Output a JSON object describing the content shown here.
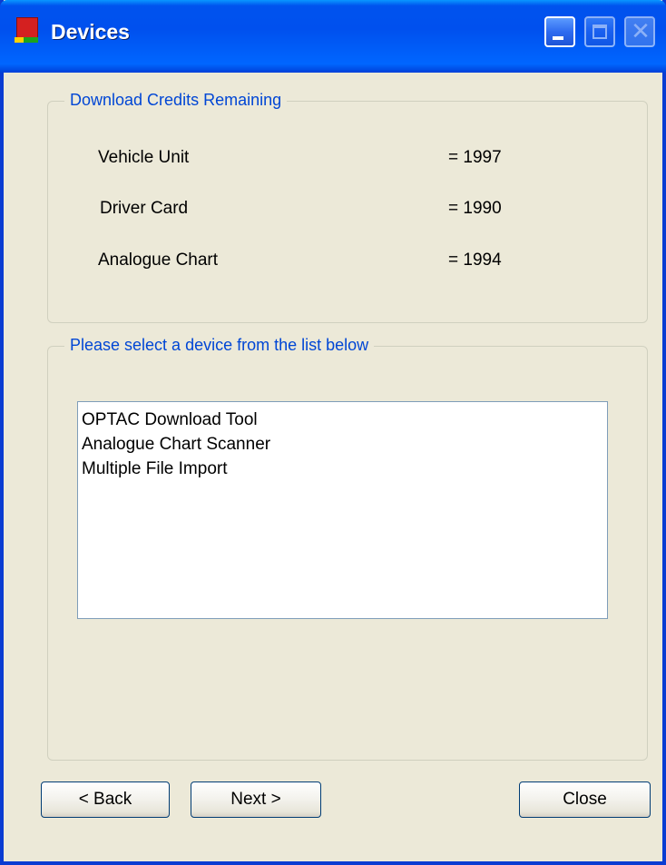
{
  "window": {
    "title": "Devices",
    "icon": "application-icon"
  },
  "title_buttons": {
    "minimize": "minimize-icon",
    "maximize": "maximize-icon",
    "close": "close-icon"
  },
  "credits": {
    "legend": "Download Credits Remaining",
    "rows": [
      {
        "label": "Vehicle Unit",
        "value": "= 1997"
      },
      {
        "label": "Driver Card",
        "value": "= 1990"
      },
      {
        "label": "Analogue Chart",
        "value": "= 1994"
      }
    ]
  },
  "devices": {
    "legend": "Please select a device from the list below",
    "items": [
      "OPTAC Download Tool",
      "Analogue Chart Scanner",
      "Multiple File Import"
    ]
  },
  "buttons": {
    "back": "< Back",
    "next": "Next >",
    "close": "Close"
  },
  "colors": {
    "titlebar": "#0053EE",
    "window_bg": "#ECE9D8",
    "legend_text": "#0046D5"
  }
}
